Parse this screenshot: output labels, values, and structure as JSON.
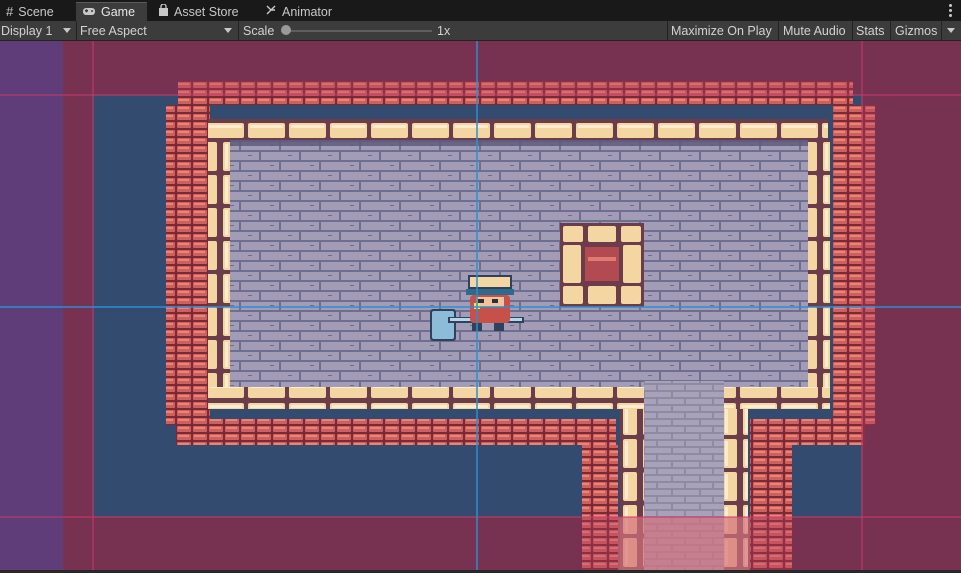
{
  "tabs": [
    {
      "label": "Scene",
      "icon": "hash-grid-icon",
      "active": false
    },
    {
      "label": "Game",
      "icon": "gamepad-icon",
      "active": true
    },
    {
      "label": "Asset Store",
      "icon": "shopping-bag-icon",
      "active": false
    },
    {
      "label": "Animator",
      "icon": "animator-icon",
      "active": false
    }
  ],
  "toolbar": {
    "display": "Display 1",
    "aspect": "Free Aspect",
    "scale_label": "Scale",
    "scale_value": "1x",
    "scale_fraction": 0.0,
    "maximize": "Maximize On Play",
    "mute": "Mute Audio",
    "stats": "Stats",
    "gizmos": "Gizmos"
  },
  "colors": {
    "background_panel": "#282828",
    "toolbar": "#3c3c3c",
    "camera_bg": "#324b6e",
    "brick": "#c85a5a",
    "floor": "#a09ab4",
    "wall_block": "#f5d7a8",
    "guide_line": "#2e8ecf",
    "overlay": "#b43c64"
  }
}
